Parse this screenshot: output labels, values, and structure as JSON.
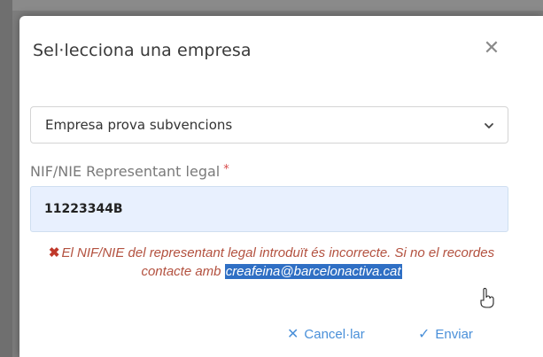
{
  "dialog": {
    "title": "Sel·lecciona una empresa",
    "close_glyph": "✕"
  },
  "company_select": {
    "selected_value": "Empresa prova subvencions",
    "icon": "chevron-down-icon"
  },
  "nif_field": {
    "label": "NIF/NIE Representant legal",
    "required_marker": "*",
    "value": "11223344B"
  },
  "error": {
    "icon_glyph": "✖",
    "text_before": "El NIF/NIE del representant legal introduït és incorrecte. Si no el recordes contacte amb ",
    "email": "creafeina@barcelonactiva.cat",
    "color": "#b3513f"
  },
  "footer": {
    "cancel_icon": "✕",
    "cancel_label": "Cancel·lar",
    "send_icon": "✓",
    "send_label": "Enviar",
    "accent_color": "#4a90d9"
  }
}
